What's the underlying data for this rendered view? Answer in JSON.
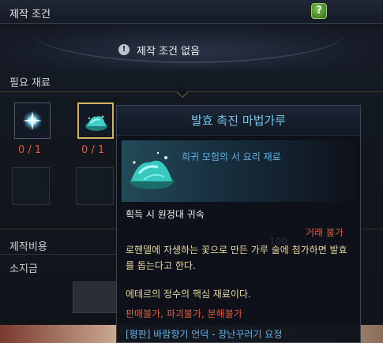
{
  "header": {
    "title": "제작 조건",
    "help_label": "?"
  },
  "condition": {
    "info_icon": "!",
    "text": "제작 조건 없음"
  },
  "materials": {
    "title": "필요 재료",
    "slots": [
      {
        "icon": "blue-star-gem-icon",
        "count": "0 / 1"
      },
      {
        "icon": "teal-powder-icon",
        "count": "0 / 1"
      }
    ]
  },
  "rows": {
    "cost_label": "제작비용",
    "gold_label": "소지금"
  },
  "tooltip": {
    "title": "발효 촉진 마법가루",
    "grade": "희귀 모험의 서 요리 재료",
    "bind": "획득 시 원정대 귀속",
    "trade": "거래 불가",
    "description": "로헨델에 자생하는 꽃으로 만든 가루 술에 첨가하면 발효를 돕는다고 한다.",
    "core": "에테르의 정수의 핵심 재료이다.",
    "restrictions": [
      "판매불가",
      "파괴불가",
      "분해불가"
    ],
    "restriction_separator": ", ",
    "source": "[평판] 바람향기 언덕 - 장난꾸러기 요정",
    "background_number": "100"
  },
  "colors": {
    "accent_blue": "#6fc6ea",
    "warning_red": "#e05a3a",
    "desc_gold": "#e8d8a0"
  }
}
